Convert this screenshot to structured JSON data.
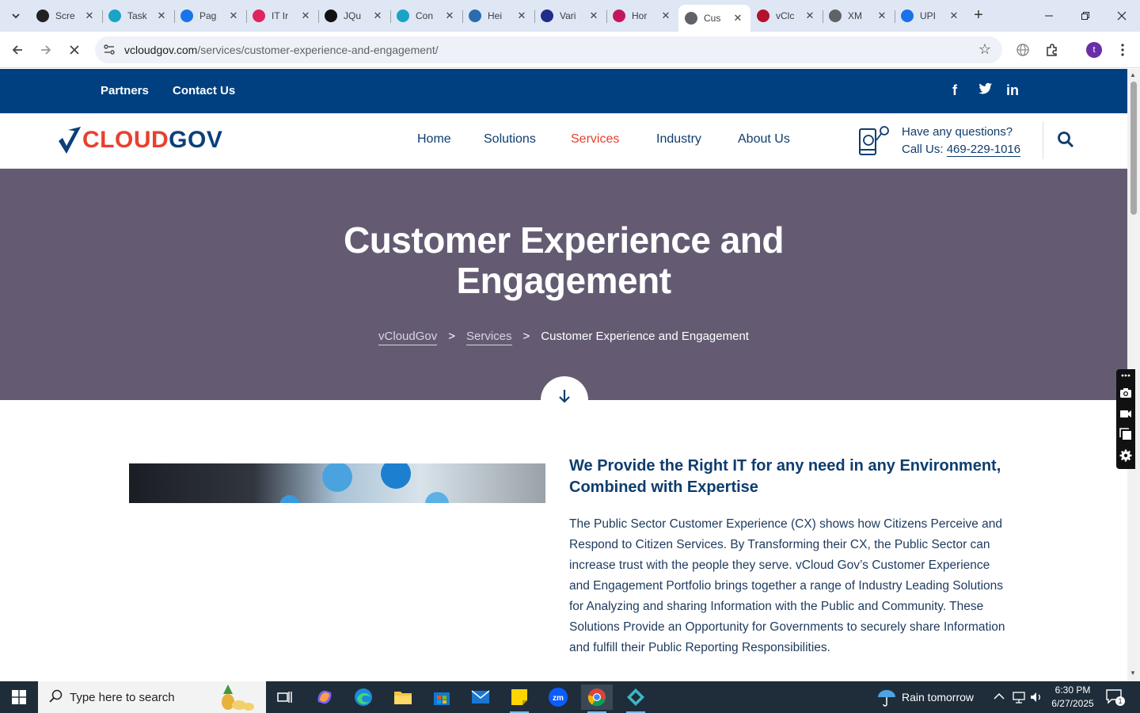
{
  "browser": {
    "tabs": [
      {
        "title": "Scre",
        "color": "#222"
      },
      {
        "title": "Task",
        "color": "#1aa3c7"
      },
      {
        "title": "Pag",
        "color": "#1a73e8"
      },
      {
        "title": "IT Ir",
        "color": "#e0245e"
      },
      {
        "title": "JQu",
        "color": "#111"
      },
      {
        "title": "Con",
        "color": "#1aa3c7"
      },
      {
        "title": "Hei",
        "color": "#2b6cb0"
      },
      {
        "title": "Vari",
        "color": "#1f2e8a"
      },
      {
        "title": "Hor",
        "color": "#c2185b"
      },
      {
        "title": "Cus",
        "color": "#5f6368"
      },
      {
        "title": "vClc",
        "color": "#b3122e"
      },
      {
        "title": "XM",
        "color": "#5f6368"
      },
      {
        "title": "UPI",
        "color": "#1a73e8"
      }
    ],
    "url_host": "vcloudgov.com",
    "url_path": "/services/customer-experience-and-engagement/",
    "profile_initial": "t"
  },
  "site": {
    "topbar": {
      "partners": "Partners",
      "contact": "Contact Us",
      "social": [
        "f",
        "t",
        "in"
      ]
    },
    "logo": {
      "part1": "CLOUD",
      "part2": "GOV"
    },
    "nav": [
      "Home",
      "Solutions",
      "Services",
      "Industry",
      "About Us"
    ],
    "active_nav": "Services",
    "contact_question": "Have any questions?",
    "contact_call_label": "Call Us:",
    "contact_phone": "469-229-1016",
    "hero_title": "Customer Experience and Engagement",
    "breadcrumb": {
      "home": "vCloudGov",
      "section": "Services",
      "current": "Customer Experience and Engagement",
      "sep": ">"
    },
    "section_heading": "We Provide the Right IT for any need in any Environment, Combined with Expertise",
    "section_body": "The Public Sector Customer Experience (CX) shows how Citizens Perceive and Respond to Citizen Services. By Transforming their CX, the Public Sector can increase trust with the people they serve. vCloud Gov’s Customer Experience and Engagement Portfolio brings together a range of Industry Leading Solutions for Analyzing and sharing Information with the Public and Community. These Solutions Provide an Opportunity for Governments to securely share Information and fulfill their Public Reporting Responsibilities."
  },
  "taskbar": {
    "search_placeholder": "Type here to search",
    "weather": "Rain tomorrow",
    "time": "6:30 PM",
    "date": "6/27/2025",
    "notification_count": "1"
  },
  "colors": {
    "brand_blue": "#004080",
    "accent_red": "#e8402f",
    "hero_bg": "#645b73"
  }
}
